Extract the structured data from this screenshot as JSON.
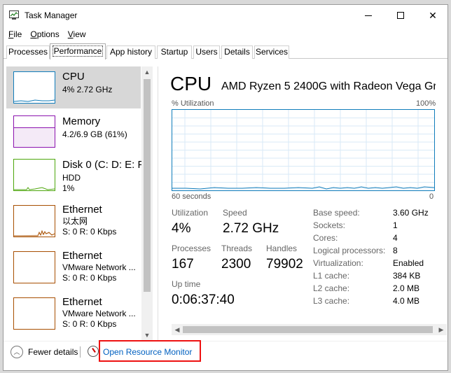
{
  "window": {
    "title": "Task Manager"
  },
  "menu": [
    {
      "label_u": "F",
      "label_rest": "ile"
    },
    {
      "label_u": "O",
      "label_rest": "ptions"
    },
    {
      "label_u": "V",
      "label_rest": "iew"
    }
  ],
  "tabs": [
    "Processes",
    "Performance",
    "App history",
    "Startup",
    "Users",
    "Details",
    "Services"
  ],
  "active_tab": "Performance",
  "sidebar": {
    "items": [
      {
        "title": "CPU",
        "line1": "4%  2.72 GHz",
        "line2": "",
        "color": "#117dbb"
      },
      {
        "title": "Memory",
        "line1": "4.2/6.9 GB (61%)",
        "line2": "",
        "color": "#8b12ae"
      },
      {
        "title": "Disk 0 (C: D: E: F",
        "line1": "HDD",
        "line2": "1%",
        "color": "#4da60c"
      },
      {
        "title": "Ethernet",
        "line1": "以太网",
        "line2": "S: 0  R: 0 Kbps",
        "color": "#a74f01"
      },
      {
        "title": "Ethernet",
        "line1": "VMware Network ...",
        "line2": "S: 0  R: 0 Kbps",
        "color": "#a74f01"
      },
      {
        "title": "Ethernet",
        "line1": "VMware Network ...",
        "line2": "S: 0  R: 0 Kbps",
        "color": "#a74f01"
      }
    ]
  },
  "main": {
    "title": "CPU",
    "model": "AMD Ryzen 5 2400G with Radeon Vega Gr...",
    "util_label": "% Utilization",
    "util_max": "100%",
    "seconds_label": "60 seconds",
    "zero_label": "0",
    "stats": {
      "utilization": {
        "label": "Utilization",
        "value": "4%"
      },
      "speed": {
        "label": "Speed",
        "value": "2.72 GHz"
      },
      "processes": {
        "label": "Processes",
        "value": "167"
      },
      "threads": {
        "label": "Threads",
        "value": "2300"
      },
      "handles": {
        "label": "Handles",
        "value": "79902"
      },
      "uptime": {
        "label": "Up time",
        "value": "0:06:37:40"
      }
    },
    "specs": [
      {
        "label": "Base speed:",
        "value": "3.60 GHz"
      },
      {
        "label": "Sockets:",
        "value": "1"
      },
      {
        "label": "Cores:",
        "value": "4"
      },
      {
        "label": "Logical processors:",
        "value": "8"
      },
      {
        "label": "Virtualization:",
        "value": "Enabled"
      },
      {
        "label": "L1 cache:",
        "value": "384 KB"
      },
      {
        "label": "L2 cache:",
        "value": "2.0 MB"
      },
      {
        "label": "L3 cache:",
        "value": "4.0 MB"
      }
    ]
  },
  "footer": {
    "fewer_details": "Fewer details",
    "open_resource_monitor": "Open Resource Monitor"
  },
  "colors": {
    "cpu_line": "#117dbb",
    "highlight_box": "#e11111",
    "link": "#0060c0"
  }
}
